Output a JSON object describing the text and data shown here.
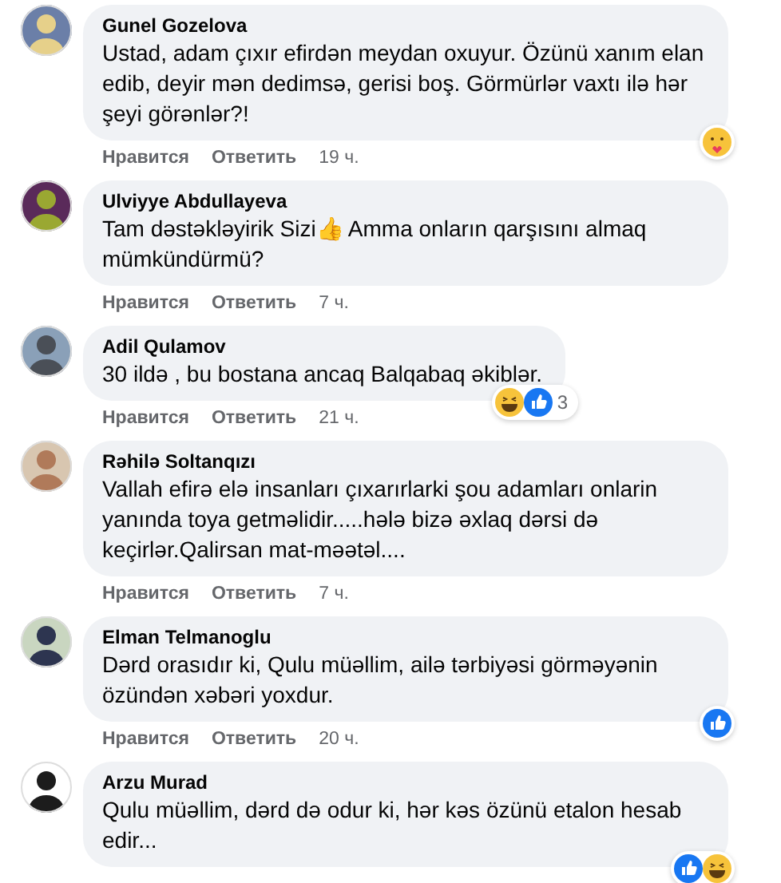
{
  "comments": [
    {
      "author": "Gunel Gozelova",
      "text": "Ustad, adam çıxır efirdən meydan oxuyur. Özünü xanım elan edib, deyir mən dedimsə, gerisi boş. Görmürlər vaxtı ilə hər şeyi görənlər?!",
      "actions": [
        "Нравится",
        "Ответить"
      ],
      "time": "19 ч.",
      "reactions": [
        {
          "kind": "care"
        }
      ]
    },
    {
      "author": "Ulviyye Abdullayeva",
      "text": "Tam dəstəkləyirik Sizi👍 Amma onların qarşısını almaq mümkündürmü?",
      "actions": [
        "Нравится",
        "Ответить"
      ],
      "time": "7 ч."
    },
    {
      "author": "Adil Qulamov",
      "text": "30 ildə , bu bostana ancaq Balqabaq əkiblər.",
      "actions": [
        "Нравится",
        "Ответить"
      ],
      "time": "21 ч.",
      "reactions": [
        {
          "kind": "haha"
        },
        {
          "kind": "like"
        }
      ],
      "reaction_count": "3"
    },
    {
      "author": "Rəhilə Soltanqızı",
      "text": "Vallah efirə elə insanları çıxarırlarki şou adamları onlarin yanında toya getməlidir.....hələ bizə əxlaq dərsi də keçirlər.Qalirsan mat-məətəl....",
      "actions": [
        "Нравится",
        "Ответить"
      ],
      "time": "7 ч."
    },
    {
      "author": "Elman Telmanoglu",
      "text": "Dərd orasıdır ki, Qulu müəllim, ailə tərbiyəsi görməyənin özündən xəbəri yoxdur.",
      "actions": [
        "Нравится",
        "Ответить"
      ],
      "time": "20 ч.",
      "reactions": [
        {
          "kind": "like"
        }
      ]
    },
    {
      "author": "Arzu Murad",
      "text": "Qulu müəllim, dərd də odur ki, hər kəs özünü etalon hesab edir...",
      "reactions": [
        {
          "kind": "like"
        },
        {
          "kind": "haha"
        }
      ]
    }
  ]
}
